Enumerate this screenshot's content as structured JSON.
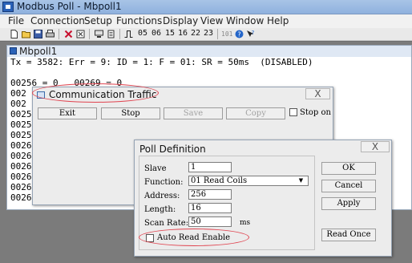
{
  "window": {
    "title": "Modbus Poll - Mbpoll1"
  },
  "menu": [
    "File",
    "Connection",
    "Setup",
    "Functions",
    "Display",
    "View",
    "Window",
    "Help"
  ],
  "toolbar": {
    "function_codes": [
      "05",
      "06",
      "15",
      "16",
      "22",
      "23"
    ],
    "code_101": "101",
    "icons": [
      "new-icon",
      "open-icon",
      "save-icon",
      "print-icon",
      "close-doc-icon",
      "delete-icon",
      "connect-icon",
      "disconnect-icon",
      "pulse-icon",
      "about-icon",
      "help-icon"
    ]
  },
  "mdi": {
    "title": "Mbpoll1",
    "status": "Tx = 3582: Err = 9: ID = 1: F = 01: SR = 50ms  (DISABLED)",
    "row0": "00256 = 0   00269 = 0",
    "row_prefixes": [
      "0025",
      "0025",
      "0025",
      "0026",
      "0026",
      "0026",
      "0026",
      "0026",
      "0026",
      "0026"
    ],
    "row_prefix_short": [
      "002",
      "002"
    ]
  },
  "comm": {
    "title": "Communication Traffic",
    "close": "X",
    "buttons": {
      "exit": "Exit",
      "stop": "Stop",
      "save": "Save",
      "copy": "Copy"
    },
    "stop_on": "Stop on"
  },
  "poll": {
    "title": "Poll Definition",
    "close": "X",
    "labels": {
      "slave": "Slave",
      "function": "Function:",
      "address": "Address:",
      "length": "Length:",
      "scan_rate": "Scan Rate:",
      "ms": "ms"
    },
    "values": {
      "slave": "1",
      "function": "01 Read Coils",
      "address": "256",
      "length": "16",
      "scan_rate": "50"
    },
    "auto_read": "Auto Read Enable",
    "buttons": {
      "ok": "OK",
      "cancel": "Cancel",
      "apply": "Apply",
      "read_once": "Read Once"
    }
  }
}
